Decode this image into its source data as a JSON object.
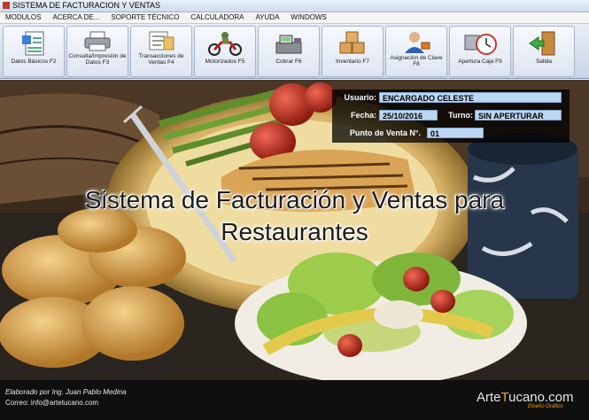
{
  "window": {
    "title": "SISTEMA DE FACTURACION Y VENTAS"
  },
  "menu": [
    "MODULOS",
    "ACERCA DE...",
    "SOPORTE TÉCNICO",
    "CALCULADORA",
    "AYUDA",
    "WINDOWS"
  ],
  "toolbar": [
    {
      "label": "Datos Básicos F2",
      "icon": "form-icon"
    },
    {
      "label": "Consulta/Impresión de Datos F3",
      "icon": "printer-icon"
    },
    {
      "label": "Transacciones de Ventas F4",
      "icon": "invoice-icon"
    },
    {
      "label": "Motorizados F5",
      "icon": "motorcycle-icon"
    },
    {
      "label": "Cobrar F6",
      "icon": "cash-register-icon"
    },
    {
      "label": "Inventario F7",
      "icon": "boxes-icon"
    },
    {
      "label": "Asignación de Clave F8",
      "icon": "user-key-icon"
    },
    {
      "label": "Apertura Caja F9",
      "icon": "clock-icon"
    },
    {
      "label": "Salida",
      "icon": "exit-door-icon"
    }
  ],
  "session": {
    "usuario_label": "Usuario:",
    "usuario": "ENCARGADO CELESTE",
    "fecha_label": "Fecha:",
    "fecha": "25/10/2016",
    "turno_label": "Turno:",
    "turno": "SIN APERTURAR",
    "punto_label": "Punto de Venta N°.",
    "punto": "01"
  },
  "banner": {
    "line1": "Sistema de Facturación y Ventas para",
    "line2": "Restaurantes"
  },
  "footer": {
    "credit": "Elaborado por Ing. Juan Pablo Medina",
    "email": "Correo: info@artetucano.com",
    "brand_a": "Arte",
    "brand_b": "ucano",
    "brand_c": ".com",
    "tagline": "Diseño Gráfico"
  },
  "colors": {
    "field_bg": "#bcd6f2",
    "brand_orange": "#f0a020"
  }
}
